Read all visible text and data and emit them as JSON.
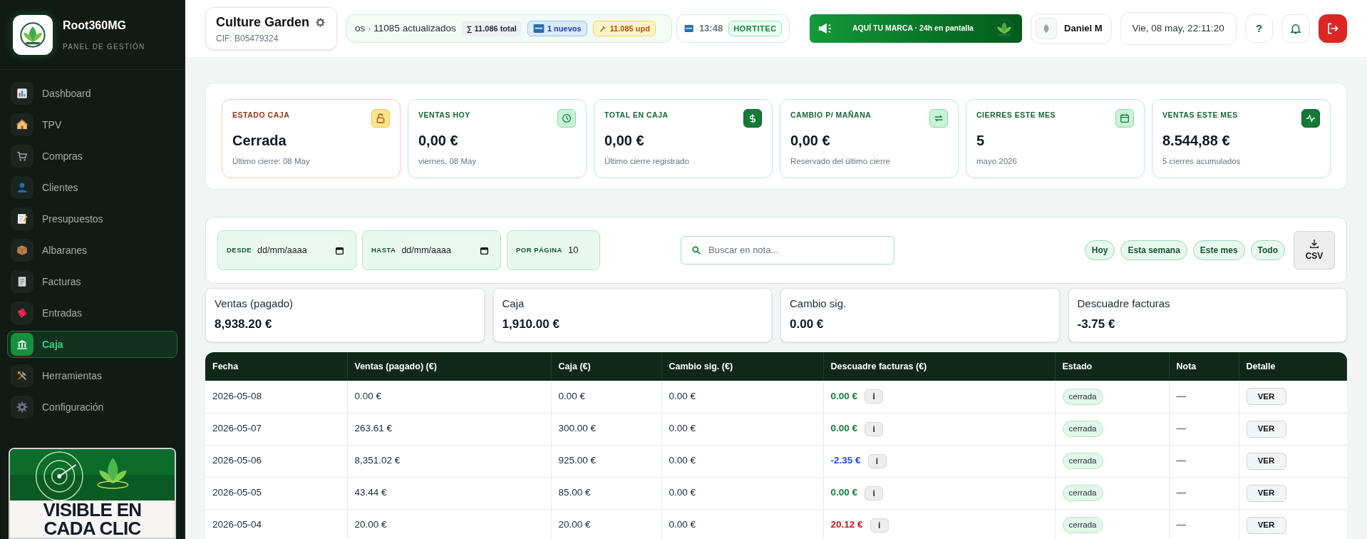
{
  "sidebar": {
    "brand": "Root360MG",
    "subtitle": "PANEL DE GESTIÓN",
    "items": [
      {
        "label": "Dashboard",
        "selected": false
      },
      {
        "label": "TPV",
        "selected": false
      },
      {
        "label": "Compras",
        "selected": false
      },
      {
        "label": "Clientes",
        "selected": false
      },
      {
        "label": "Presupuestos",
        "selected": false
      },
      {
        "label": "Albaranes",
        "selected": false
      },
      {
        "label": "Facturas",
        "selected": false
      },
      {
        "label": "Entradas",
        "selected": false
      },
      {
        "label": "Caja",
        "selected": true
      },
      {
        "label": "Herramientas",
        "selected": false
      },
      {
        "label": "Configuración",
        "selected": false
      }
    ],
    "promo": {
      "lines": [
        "VISIBLE EN",
        "CADA CLIC"
      ]
    }
  },
  "header": {
    "company": "Culture Garden",
    "cif": "CIF: B05479324",
    "ticker": {
      "text": "os · 11085 actualizados",
      "total": "∑ 11.086 total",
      "new": "1 nuevos",
      "updated": "11.085 upd"
    },
    "news": {
      "time": "13:48",
      "source": "HORTITEC"
    },
    "ad": "AQUÍ TU MARCA · 24h en pantalla",
    "user": "Daniel M",
    "datetime": "Vie, 08 may, 22:11:20",
    "help": "?"
  },
  "stats": [
    {
      "label": "ESTADO CAJA",
      "value": "Cerrada",
      "note": "Último cierre: 08 May",
      "kind": "alert",
      "icon_filled": false
    },
    {
      "label": "VENTAS HOY",
      "value": "0,00 €",
      "note": "viernes, 08 May",
      "kind": "normal",
      "icon_filled": false
    },
    {
      "label": "TOTAL EN CAJA",
      "value": "0,00 €",
      "note": "Último cierre registrado",
      "kind": "normal",
      "icon_filled": true
    },
    {
      "label": "CAMBIO P/ MAÑANA",
      "value": "0,00 €",
      "note": "Reservado del último cierre",
      "kind": "normal",
      "icon_filled": false
    },
    {
      "label": "CIERRES ESTE MES",
      "value": "5",
      "note": "mayo 2026",
      "kind": "normal",
      "icon_filled": false
    },
    {
      "label": "VENTAS ESTE MES",
      "value": "8.544,88 €",
      "note": "5 cierres acumulados",
      "kind": "normal",
      "icon_filled": true
    }
  ],
  "filters": {
    "from": {
      "label": "DESDE",
      "placeholder": "dd/mm/aaaa"
    },
    "to": {
      "label": "HASTA",
      "placeholder": "dd/mm/aaaa"
    },
    "per_page": {
      "label": "POR PÁGINA",
      "value": "10"
    },
    "search": {
      "placeholder": "Buscar en nota..."
    },
    "quick": [
      "Hoy",
      "Esta semana",
      "Este mes",
      "Todo"
    ],
    "export": "CSV"
  },
  "summary": [
    {
      "label": "Ventas (pagado)",
      "value": "8,938.20 €"
    },
    {
      "label": "Caja",
      "value": "1,910.00 €"
    },
    {
      "label": "Cambio sig.",
      "value": "0.00 €"
    },
    {
      "label": "Descuadre facturas",
      "value": "-3.75 €"
    }
  ],
  "table": {
    "columns": [
      "Fecha",
      "Ventas (pagado) (€)",
      "Caja (€)",
      "Cambio sig. (€)",
      "Descuadre facturas (€)",
      "Estado",
      "Nota",
      "Detalle"
    ],
    "rows": [
      {
        "date": "2026-05-08",
        "sales": "0.00 €",
        "cash": "0.00 €",
        "change": "0.00 €",
        "diff": "0.00 €",
        "color": "#15803d",
        "info": "i",
        "status": "cerrada",
        "note": "—",
        "action": "VER"
      },
      {
        "date": "2026-05-07",
        "sales": "263.61 €",
        "cash": "300.00 €",
        "change": "0.00 €",
        "diff": "0.00 €",
        "color": "#15803d",
        "info": "i",
        "status": "cerrada",
        "note": "—",
        "action": "VER"
      },
      {
        "date": "2026-05-06",
        "sales": "8,351.02 €",
        "cash": "925.00 €",
        "change": "0.00 €",
        "diff": "-2.35 €",
        "color": "#1d4ed8",
        "info": "i",
        "status": "cerrada",
        "note": "—",
        "action": "VER"
      },
      {
        "date": "2026-05-05",
        "sales": "43.44 €",
        "cash": "85.00 €",
        "change": "0.00 €",
        "diff": "0.00 €",
        "color": "#15803d",
        "info": "i",
        "status": "cerrada",
        "note": "—",
        "action": "VER"
      },
      {
        "date": "2026-05-04",
        "sales": "20.00 €",
        "cash": "20.00 €",
        "change": "0.00 €",
        "diff": "20.12 €",
        "color": "#b91c1c",
        "info": "i",
        "status": "cerrada",
        "note": "—",
        "action": "VER"
      }
    ]
  }
}
